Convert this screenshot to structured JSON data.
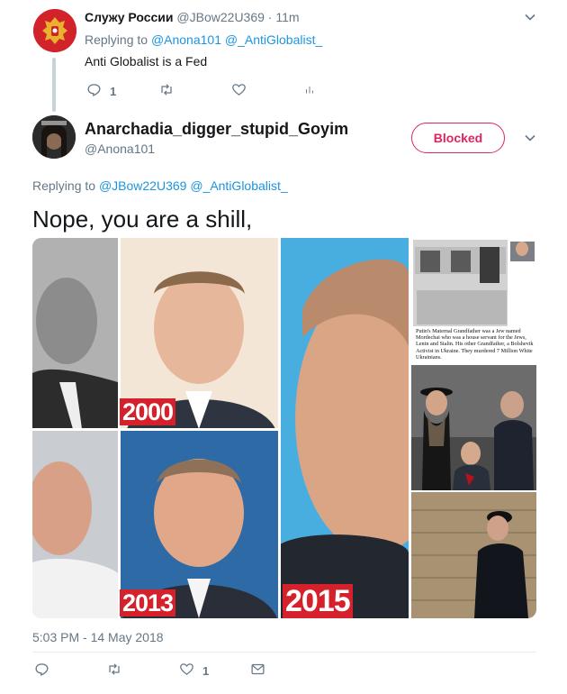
{
  "parent_tweet": {
    "display_name": "Служу России",
    "handle_time": "@JBow22U369 · 11m",
    "replying_prefix": "Replying to ",
    "replying_to": "@Anona101 @_AntiGlobalist_",
    "text": "Anti Globalist is a Fed",
    "reply_count": "1"
  },
  "main_tweet": {
    "display_name": "Anarchadia_digger_stupid_Goyim",
    "handle": "@Anona101",
    "blocked_label": "Blocked",
    "replying_prefix": "Replying to ",
    "replying_to": "@JBow22U369 @_AntiGlobalist_",
    "text": "Nope, you are a shill,",
    "timestamp": "5:03 PM - 14 May 2018",
    "like_count": "1"
  },
  "media": {
    "left_image": {
      "labels": [
        "2000",
        "2013",
        "2015"
      ]
    },
    "collage_caption": "Putin's Maternal Grandfather was a Jew named Mordechai who was a house servant for the Jews, Lenin and Stalin. His other Grandfather, a Bolshevik Activist in Ukraine. They murdered 7 Million White Ukrainians."
  },
  "colors": {
    "link": "#1b95e0",
    "muted": "#657786",
    "blocked": "#e0245e",
    "year_badge": "#d4212b"
  },
  "icons": {
    "reply": "reply-icon",
    "retweet": "retweet-icon",
    "like": "heart-icon",
    "message": "envelope-icon",
    "analytics": "analytics-icon",
    "chevron": "chevron-down-icon"
  }
}
